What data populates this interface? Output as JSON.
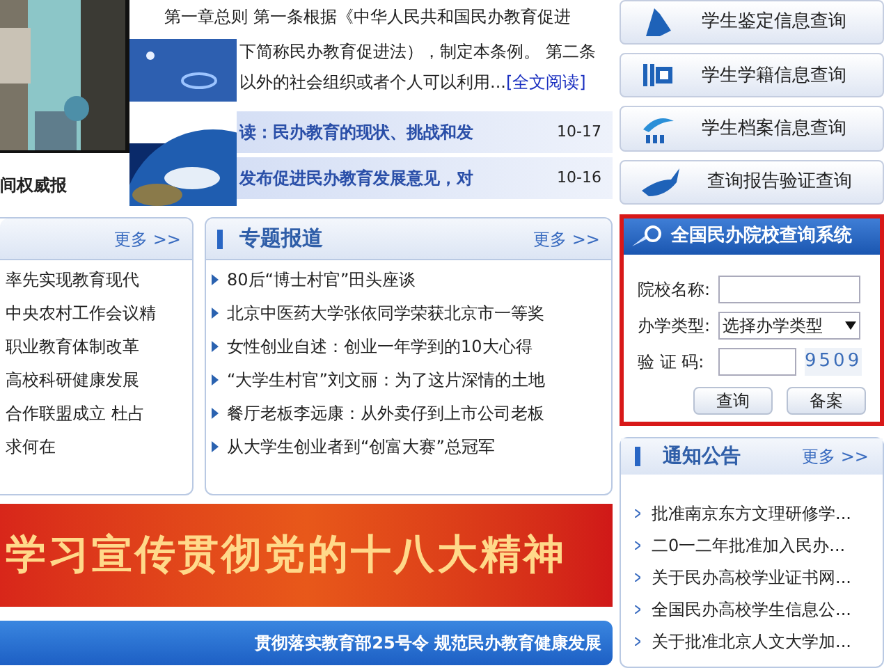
{
  "headline_caption": "间权威报",
  "intro": {
    "lines": [
      "第一章总则 第一条根据《中华人民共和国民办教育促进",
      "下简称民办教育促进法），制定本条例。 第二条",
      "以外的社会组织或者个人可以利用..."
    ],
    "link": "[全文阅读]"
  },
  "top_news": [
    {
      "title": "读：民办教育的现状、挑战和发",
      "date": "10-17"
    },
    {
      "title": "发布促进民办教育发展意见，对",
      "date": "10-16"
    }
  ],
  "panels": [
    {
      "kind": "plain",
      "more": "更多 >>",
      "items": [
        "率先实现教育现代",
        "中央农村工作会议精",
        "职业教育体制改革",
        "高校科研健康发展",
        "合作联盟成立  杜占",
        "求何在"
      ]
    },
    {
      "title": "专题报道",
      "more": "更多 >>",
      "items": [
        "80后“博士村官”田头座谈",
        "北京中医药大学张依同学荣获北京市一等奖",
        "女性创业自述：创业一年学到的10大心得",
        "“大学生村官”刘文丽：为了这片深情的土地",
        "餐厅老板李远康：从外卖仔到上市公司老板",
        "从大学生创业者到“创富大赛”总冠军"
      ],
      "kind": "bulleted"
    }
  ],
  "banner": "学习宣传贯彻党的十八大精神",
  "slogan": "贯彻落实教育部25号令  规范民办教育健康发展",
  "quick_links": [
    {
      "label": "学生鉴定信息查询"
    },
    {
      "label": "学生学籍信息查询"
    },
    {
      "label": "学生档案信息查询"
    },
    {
      "label": "查询报告验证查询"
    }
  ],
  "search": {
    "title": "全国民办院校查询系统",
    "fields": [
      {
        "kind": "text",
        "label": "院校名称:"
      },
      {
        "kind": "select",
        "label": "办学类型:",
        "value": "选择办学类型"
      },
      {
        "kind": "captcha",
        "label": "验 证 码:",
        "code": "9509"
      }
    ],
    "buttons": [
      "查询",
      "备案"
    ]
  },
  "notices": {
    "title": "通知公告",
    "more": "更多 >>",
    "items": [
      "批准南京东方文理研修学...",
      "二0一二年批准加入民办...",
      "关于民办高校学业证书网...",
      "全国民办高校学生信息公...",
      "关于批准北京人文大学加..."
    ]
  }
}
